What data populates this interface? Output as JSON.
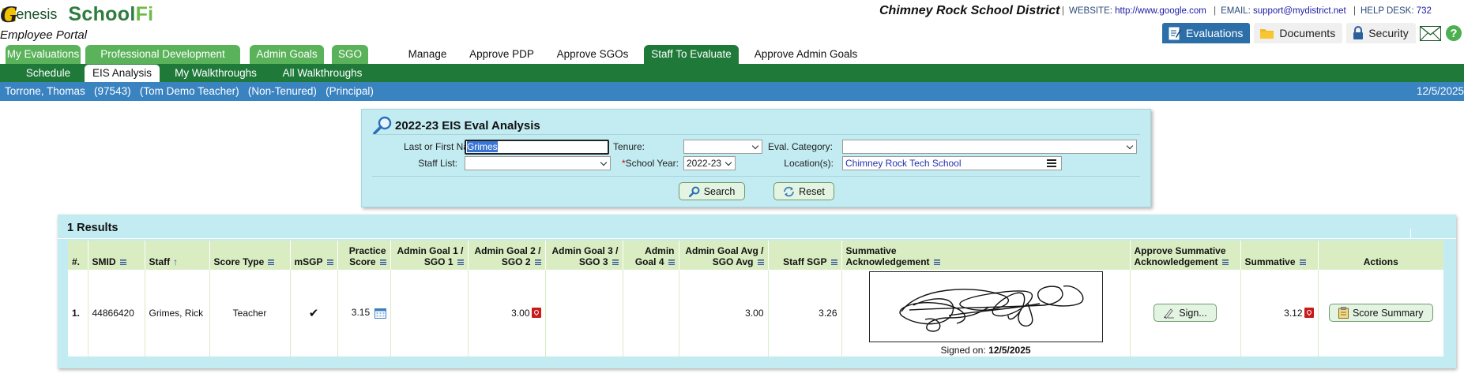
{
  "header": {
    "logo_genesis": "enesis",
    "logo_g": "G",
    "logo_school": "School",
    "logo_fi": "Fi",
    "portal": "Employee Portal",
    "district": "Chimney Rock School District",
    "website_label": "WEBSITE:",
    "website_url": "http://www.google.com",
    "email_label": "EMAIL:",
    "email": "support@mydistrict.net",
    "helpdesk_label": "HELP DESK:",
    "helpdesk": "732",
    "buttons": {
      "evaluations": "Evaluations",
      "documents": "Documents",
      "security": "Security"
    },
    "icons": {
      "evaluations": "edit-note-icon",
      "documents": "folder-icon",
      "security": "lock-icon",
      "mail": "mail-icon",
      "help": "help-icon"
    }
  },
  "nav": {
    "tabs": [
      "My Evaluations",
      "Professional Development",
      "Admin Goals",
      "SGO",
      "Manage",
      "Approve PDP",
      "Approve SGOs",
      "Staff To Evaluate",
      "Approve Admin Goals"
    ],
    "active_tab": "Staff To Evaluate",
    "subtabs": [
      "Schedule",
      "EIS Analysis",
      "My Walkthroughs",
      "All Walkthroughs"
    ],
    "active_subtab": "EIS Analysis"
  },
  "info_bar": {
    "left": "Torrone, Thomas   (97543)   (Tom Demo Teacher)   (Non-Tenured)   (Principal)",
    "date": "12/5/2025"
  },
  "search": {
    "title": "2022-23 EIS Eval Analysis",
    "title_icon": "magnifier-icon",
    "name_label": "Last or First Name:",
    "name_value": "Grimes",
    "tenure_label": "Tenure:",
    "tenure_value": "",
    "eval_category_label": "Eval. Category:",
    "eval_category_value": "",
    "staff_list_label": "Staff List:",
    "staff_list_value": "",
    "school_year_req": "*",
    "school_year_label": "School Year:",
    "school_year_value": "2022-23",
    "location_label": "Location(s):",
    "location_value": "Chimney Rock Tech School",
    "search_button": "Search",
    "reset_button": "Reset"
  },
  "results": {
    "count_label": "1 Results",
    "columns": {
      "num": "#.",
      "smid": "SMID",
      "staff": "Staff",
      "score_type": "Score Type",
      "msgp": "mSGP",
      "practice_1": "Practice",
      "practice_2": "Score",
      "ag1_1": "Admin Goal 1 /",
      "ag1_2": "SGO 1",
      "ag2_1": "Admin Goal 2 /",
      "ag2_2": "SGO 2",
      "ag3_1": "Admin Goal 3 /",
      "ag3_2": "SGO 3",
      "ag4_1": "Admin",
      "ag4_2": "Goal 4",
      "agavg_1": "Admin Goal Avg /",
      "agavg_2": "SGO Avg",
      "staff_sgp": "Staff SGP",
      "sum_ack_1": "Summative",
      "sum_ack_2": "Acknowledgement",
      "appr_1": "Approve Summative",
      "appr_2": "Acknowledgement",
      "summative": "Summative",
      "actions": "Actions"
    },
    "rows": [
      {
        "num": "1.",
        "smid": "44866420",
        "staff": "Grimes, Rick",
        "score_type": "Teacher",
        "msgp": "✔",
        "practice": "3.15",
        "ag1": "",
        "ag2": "3.00",
        "ag3": "",
        "ag4": "",
        "agavg": "3.00",
        "staff_sgp": "3.26",
        "signed_label": "Signed on:",
        "signed_date": "12/5/2025",
        "sign_button": "Sign...",
        "summative": "3.12",
        "action_button": "Score Summary"
      }
    ]
  },
  "colors": {
    "nav_green": "#5ab25a",
    "dark_green": "#1f7a3a",
    "info_blue": "#3a83c1",
    "panel_cyan": "#c2ecf2",
    "header_green": "#d9ecc2"
  }
}
